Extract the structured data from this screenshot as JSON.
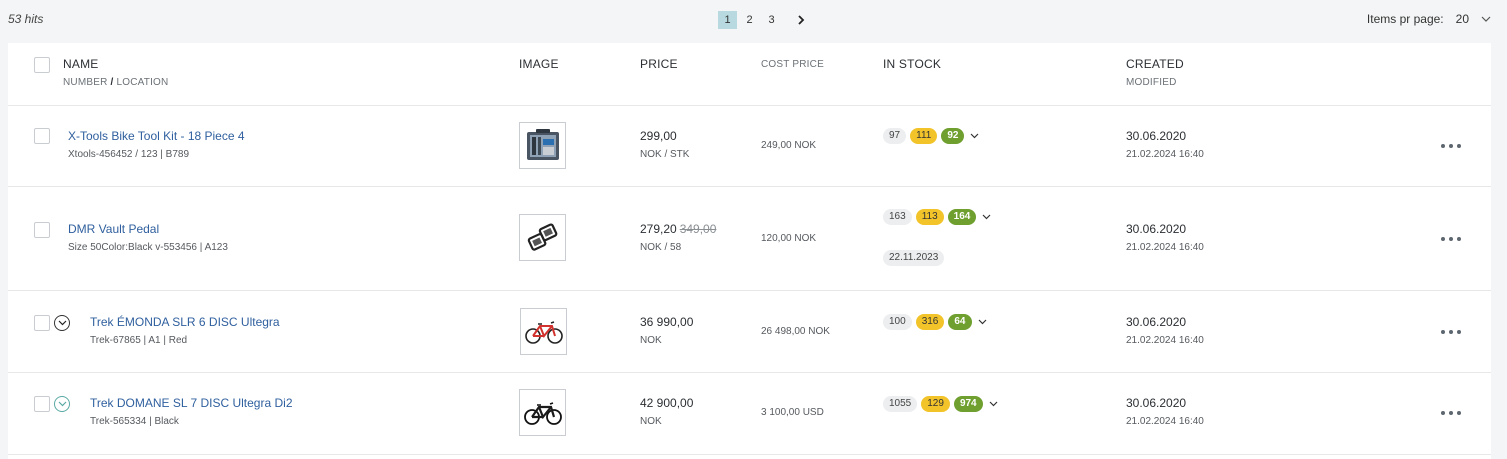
{
  "hits_label": "53 hits",
  "pagination": {
    "pages": [
      "1",
      "2",
      "3"
    ],
    "active": "1"
  },
  "items_per_page": {
    "label": "Items pr page:",
    "value": "20"
  },
  "columns": {
    "name": "NAME",
    "number": "NUMBER",
    "slash": " / ",
    "location": "LOCATION",
    "image": "IMAGE",
    "price": "PRICE",
    "cost_price": "COST PRICE",
    "in_stock": "IN STOCK",
    "created": "CREATED",
    "modified": "MODIFIED"
  },
  "rows": [
    {
      "name": "X-Tools Bike Tool Kit - 18 Piece 4",
      "meta": "Xtools-456452 / 123    |    B789",
      "price": "299,00",
      "old_price": "",
      "unit": "NOK / STK",
      "cost": "249,00 NOK",
      "stock": [
        "97",
        "111",
        "92"
      ],
      "stock_date": "",
      "created": "30.06.2020",
      "modified": "21.02.2024 16:40",
      "image_icon": "toolkit-icon"
    },
    {
      "name": "DMR Vault Pedal",
      "meta": "Size 50Color:Black   v-553456    |    A123",
      "price": "279,20",
      "old_price": "349,00",
      "unit": "NOK / 58",
      "cost": "120,00 NOK",
      "stock": [
        "163",
        "113",
        "164"
      ],
      "stock_date": "22.11.2023",
      "created": "30.06.2020",
      "modified": "21.02.2024 16:40",
      "image_icon": "pedal-icon"
    },
    {
      "name": "Trek ÉMONDA SLR 6 DISC Ultegra",
      "meta": "Trek-67865    |    A1    |    Red",
      "price": "36 990,00",
      "old_price": "",
      "unit": "NOK",
      "cost": "26 498,00 NOK",
      "stock": [
        "100",
        "316",
        "64"
      ],
      "stock_date": "",
      "created": "30.06.2020",
      "modified": "21.02.2024 16:40",
      "image_icon": "red-bike-icon"
    },
    {
      "name": "Trek DOMANE SL 7 DISC Ultegra Di2",
      "meta": "Trek-565334    |    Black",
      "price": "42 900,00",
      "old_price": "",
      "unit": "NOK",
      "cost": "3 100,00 USD",
      "stock": [
        "1055",
        "129",
        "974"
      ],
      "stock_date": "",
      "created": "30.06.2020",
      "modified": "21.02.2024 16:40",
      "image_icon": "black-bike-icon"
    }
  ]
}
